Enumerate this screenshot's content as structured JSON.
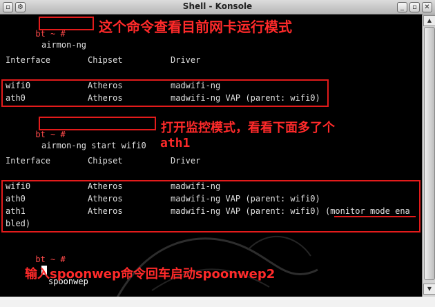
{
  "window": {
    "title": "Shell - Konsole",
    "buttons": {
      "left1": "▫",
      "left2": "⚙",
      "min": "_",
      "max": "▫",
      "close": "✕"
    }
  },
  "terminal": {
    "prompt": "bt ~ #",
    "cmd1": "airmon-ng",
    "note1": "这个命令查看目前网卡运行模式",
    "header": {
      "interface": "Interface",
      "chipset": "Chipset",
      "driver": "Driver"
    },
    "table1": [
      {
        "interface": "wifi0",
        "chipset": "Atheros",
        "driver": "madwifi-ng"
      },
      {
        "interface": "ath0",
        "chipset": "Atheros",
        "driver": "madwifi-ng VAP (parent: wifi0)"
      }
    ],
    "cmd2": "airmon-ng start wifi0",
    "note2_line1": "打开监控模式，看看下面多了个",
    "note2_line2": "ath1",
    "table2": [
      {
        "interface": "wifi0",
        "chipset": "Atheros",
        "driver": "madwifi-ng"
      },
      {
        "interface": "ath0",
        "chipset": "Atheros",
        "driver": "madwifi-ng VAP (parent: wifi0)"
      },
      {
        "interface": "ath1",
        "chipset": "Atheros",
        "driver": "madwifi-ng VAP (parent: wifi0) (",
        "driver_highlight": "monitor mode ena"
      }
    ],
    "wrap": "bled)",
    "cmd3": "spoonwep",
    "note3": "输入spoonwep命令回车启动spoonwep2"
  },
  "colors": {
    "prompt": "#ff4a4a",
    "annotation": "#ff2a2a",
    "box": "#e31b1b",
    "text": "#e0e0e0"
  }
}
